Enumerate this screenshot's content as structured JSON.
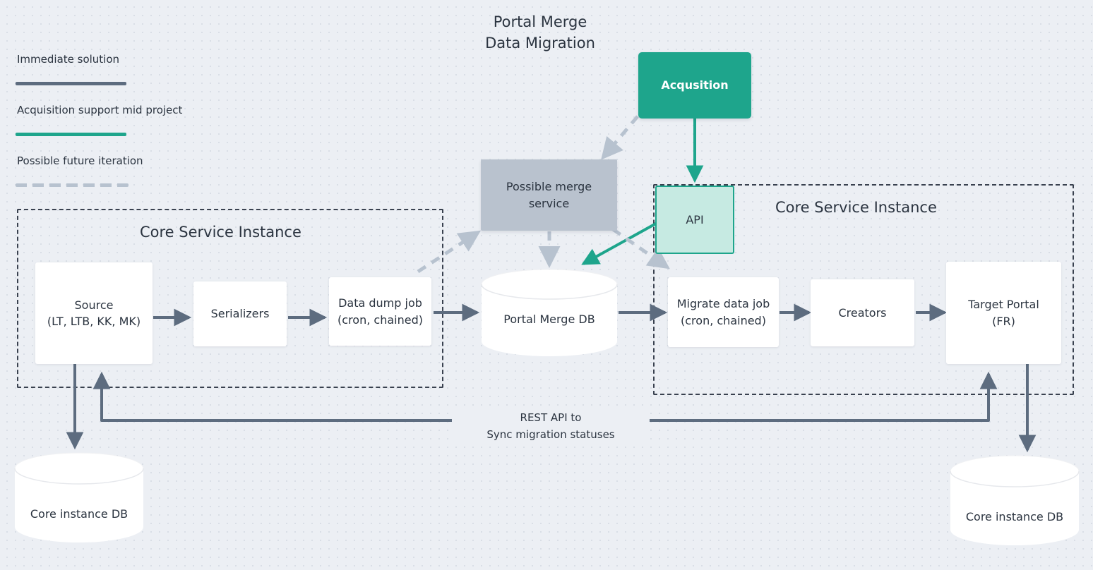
{
  "diagram": {
    "title": "Portal Merge\nData Migration",
    "background_color": "#eceff4",
    "accent_color": "#1ea58c",
    "immediate_color": "#5d6c7f",
    "future_color": "#b7c2cf"
  },
  "legend": {
    "items": [
      {
        "label": "Immediate solution",
        "color": "#5d6c7f",
        "style": "solid"
      },
      {
        "label": "Acquisition support mid project",
        "color": "#1ea58c",
        "style": "solid"
      },
      {
        "label": "Possible future iteration",
        "color": "#b7c2cf",
        "style": "dashed"
      }
    ]
  },
  "groups": [
    {
      "title": "Core Service Instance"
    },
    {
      "title": "Core Service Instance"
    }
  ],
  "nodes": {
    "acqusition": "Acqusition",
    "api": "API",
    "possible_merge_service": "Possible merge\nservice",
    "source": "Source\n(LT, LTB, KK, MK)",
    "serializers": "Serializers",
    "data_dump_job": "Data dump job\n(cron, chained)",
    "portal_merge_db": "Portal Merge DB",
    "migrate_data_job": "Migrate data job\n(cron, chained)",
    "creators": "Creators",
    "target_portal": "Target Portal\n(FR)",
    "core_instance_db_left": "Core instance DB",
    "core_instance_db_right": "Core instance DB"
  },
  "edges": {
    "rest_api_label": "REST API to\nSync migration statuses"
  }
}
